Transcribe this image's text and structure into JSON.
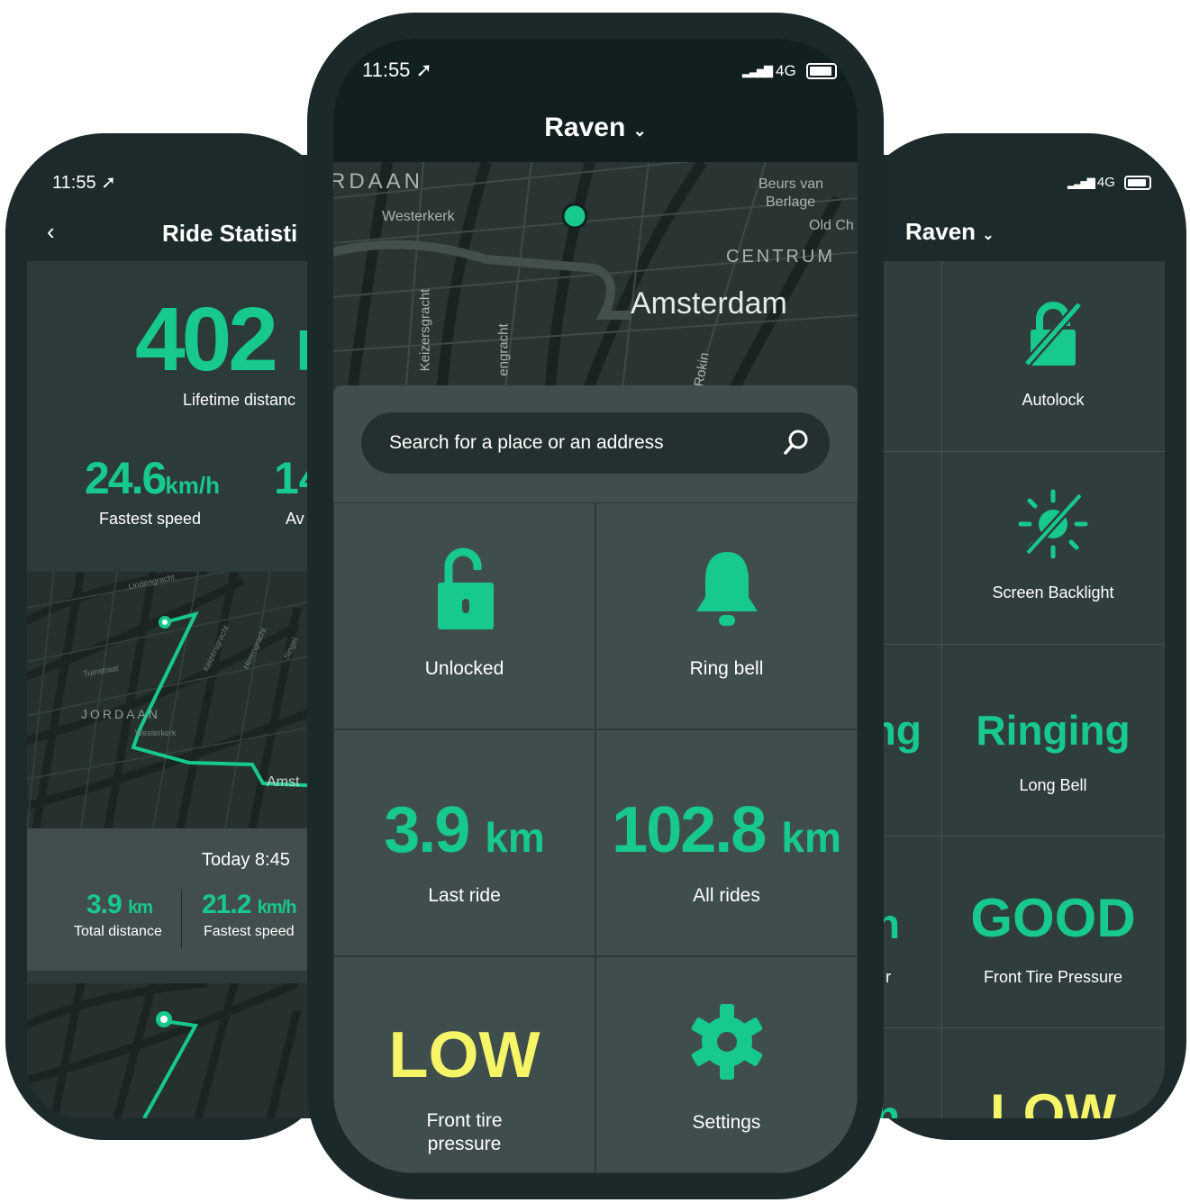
{
  "left": {
    "time": "11:55",
    "title": "Ride Statisti",
    "lifetime_value": "402",
    "lifetime_unit_partial": "k",
    "lifetime_label": "Lifetime distanc",
    "fastest_value": "24.6",
    "fastest_unit": "km/h",
    "fastest_label": "Fastest speed",
    "avg_value_partial": "14",
    "avg_label_partial": "Av",
    "map_labels": [
      "Lindengracht",
      "Tuinstraat",
      "JORDAAN",
      "Westerkerk",
      "Keizersgracht",
      "Herengracht",
      "Singel",
      "Amst"
    ],
    "ride_time": "Today 8:45",
    "ride_distance_value": "3.9",
    "ride_distance_unit": "km",
    "ride_distance_label": "Total distance",
    "ride_speed_value": "21.2",
    "ride_speed_unit": "km/h",
    "ride_speed_label": "Fastest speed"
  },
  "center": {
    "time": "11:55",
    "network": "4G",
    "title": "Raven",
    "map_labels": {
      "jordaan": "RDAAN",
      "westerkerk": "Westerkerk",
      "beurs": "Beurs van",
      "berlage": "Berlage",
      "oldch": "Old Ch",
      "centrum": "CENTRUM",
      "amsterdam": "Amsterdam",
      "keizers": "Keizersgracht",
      "hereng": "engracht",
      "rokin": "Rokin"
    },
    "search_placeholder": "Search for a place or an address",
    "tiles": {
      "lock_label": "Unlocked",
      "bell_label": "Ring bell",
      "last_ride_value": "3.9",
      "last_ride_unit": "km",
      "last_ride_label": "Last ride",
      "all_rides_value": "102.8",
      "all_rides_unit": "km",
      "all_rides_label": "All rides",
      "tire_value": "LOW",
      "tire_label_1": "Front tire",
      "tire_label_2": "pressure",
      "settings_label": "Settings"
    }
  },
  "right": {
    "network": "4G",
    "title": "Raven",
    "autolock_label": "Autolock",
    "backlight_label": "Screen Backlight",
    "bell_value": "Ringing",
    "bell_value_partial": "ng",
    "bell_label": "Long Bell",
    "tire_value": "GOOD",
    "tire_value_partial": "n",
    "tire_label": "Front Tire Pressure",
    "tire_label_partial": "r",
    "bottom_value": "LOW",
    "bottom_value_partial": "n"
  },
  "colors": {
    "accent": "#17c98c",
    "warning": "#f6f567",
    "bg_dark": "#1c2a2c",
    "tile": "#3f4e4d"
  }
}
